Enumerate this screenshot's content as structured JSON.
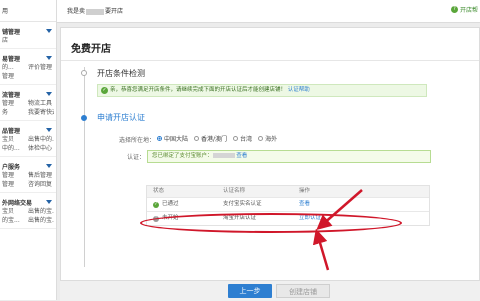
{
  "sidebar": {
    "top": "用",
    "groups": [
      {
        "title": "铺管理",
        "rows": [
          [
            "店",
            ""
          ]
        ]
      },
      {
        "title": "易管理",
        "rows": [
          [
            "的...",
            "评价管理"
          ],
          [
            "管理",
            ""
          ]
        ]
      },
      {
        "title": "流管理",
        "rows": [
          [
            "管理",
            "物流工具"
          ],
          [
            "务",
            "我要寄快递"
          ]
        ]
      },
      {
        "title": "品管理",
        "rows": [
          [
            "宝贝",
            "出售中的..."
          ],
          [
            "中的...",
            "体检中心"
          ]
        ]
      },
      {
        "title": "户服务",
        "rows": [
          [
            "管理",
            "售后管理"
          ],
          [
            "管理",
            "咨询回复"
          ]
        ]
      },
      {
        "title": "外网络交易",
        "rows": [
          [
            "宝贝",
            "出售的宝..."
          ],
          [
            "的宝...",
            "出售的宝..."
          ]
        ]
      }
    ]
  },
  "topbar": {
    "greet_prefix": "我是卖",
    "greet_suffix": "要开店",
    "right_label": "开店帮"
  },
  "main": {
    "title": "免费开店",
    "step1_title": "开店条件检测",
    "notice_text": "亲，恭喜您满足开店条件，请继续完成下面的开店认证后才能创建店铺！",
    "notice_link": "认证帮助",
    "step2_title": "申请开店认证",
    "location_label": "选择所在地：",
    "locations": [
      "中国大陆",
      "香港/澳门",
      "台湾",
      "海外"
    ],
    "cert_label": "认证：",
    "cert_text_prefix": "您已绑定了支付宝账户：",
    "cert_link": "查看"
  },
  "table": {
    "headers": [
      "状态",
      "认证名称",
      "操作"
    ],
    "rows": [
      {
        "status": "已通过",
        "name": "支付宝实名认证",
        "action": "查看"
      },
      {
        "status": "未开始",
        "name": "淘宝开店认证",
        "action": "立即认证"
      }
    ]
  },
  "footer": {
    "prev_label": "上一步",
    "create_label": "创建店铺"
  },
  "colors": {
    "accent": "#2e7fd1",
    "success": "#5aa63a",
    "highlight": "#d0172a"
  }
}
